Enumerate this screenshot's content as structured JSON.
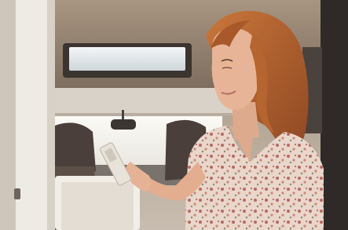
{
  "scene": {
    "kind": "photograph",
    "colors": {
      "ceiling": "#8a7a6a",
      "skylight": "#dfe6e9",
      "window": "#f2f1ec",
      "seat": "#4a3f3a",
      "door_frame": "#eeeae4",
      "hair": "#b5652f",
      "skin": "#e8b497",
      "dress": "#e6cfc2",
      "pattern": "#b56b63",
      "phone": "#e9e2d8"
    }
  }
}
